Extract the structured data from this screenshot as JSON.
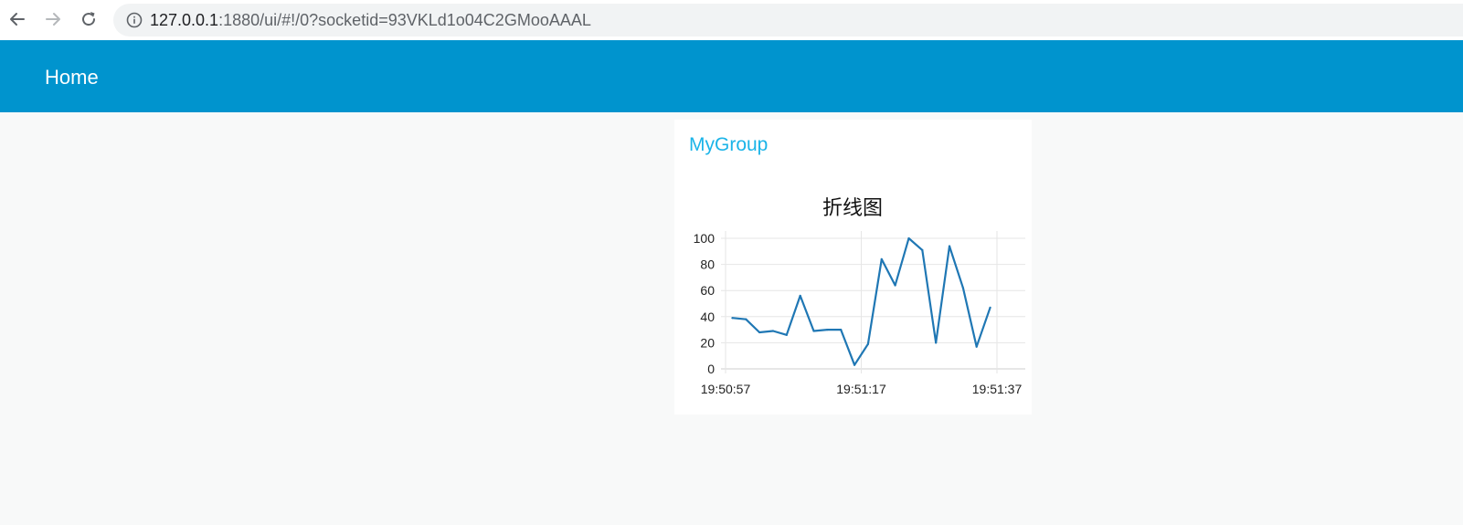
{
  "browser": {
    "url_host": "127.0.0.1",
    "url_rest": ":1880/ui/#!/0?socketid=93VKLd1o04C2GMooAAAL",
    "icons": {
      "back": "arrow-left-icon",
      "forward": "arrow-right-icon",
      "reload": "reload-icon",
      "info": "info-icon"
    }
  },
  "header": {
    "title": "Home",
    "color": "#0094ce"
  },
  "group": {
    "title": "MyGroup",
    "title_color": "#1bb4e8"
  },
  "chart_data": {
    "type": "line",
    "title": "折线图",
    "xlabel": "",
    "ylabel": "",
    "x_ticks": [
      "19:50:57",
      "19:51:17",
      "19:51:37"
    ],
    "y_ticks": [
      "0",
      "20",
      "40",
      "60",
      "80",
      "100"
    ],
    "ylim": [
      0,
      100
    ],
    "x_range_seconds": [
      0,
      40
    ],
    "grid": true,
    "series": [
      {
        "color": "#1f77b4",
        "points": [
          {
            "t": 1,
            "y": 39
          },
          {
            "t": 3,
            "y": 38
          },
          {
            "t": 5,
            "y": 28
          },
          {
            "t": 7,
            "y": 29
          },
          {
            "t": 9,
            "y": 26
          },
          {
            "t": 11,
            "y": 56
          },
          {
            "t": 13,
            "y": 29
          },
          {
            "t": 15,
            "y": 30
          },
          {
            "t": 17,
            "y": 30
          },
          {
            "t": 19,
            "y": 3
          },
          {
            "t": 21,
            "y": 19
          },
          {
            "t": 23,
            "y": 84
          },
          {
            "t": 25,
            "y": 64
          },
          {
            "t": 27,
            "y": 100
          },
          {
            "t": 29,
            "y": 91
          },
          {
            "t": 31,
            "y": 20
          },
          {
            "t": 33,
            "y": 94
          },
          {
            "t": 35,
            "y": 62
          },
          {
            "t": 37,
            "y": 17
          },
          {
            "t": 39,
            "y": 47
          }
        ]
      }
    ]
  }
}
